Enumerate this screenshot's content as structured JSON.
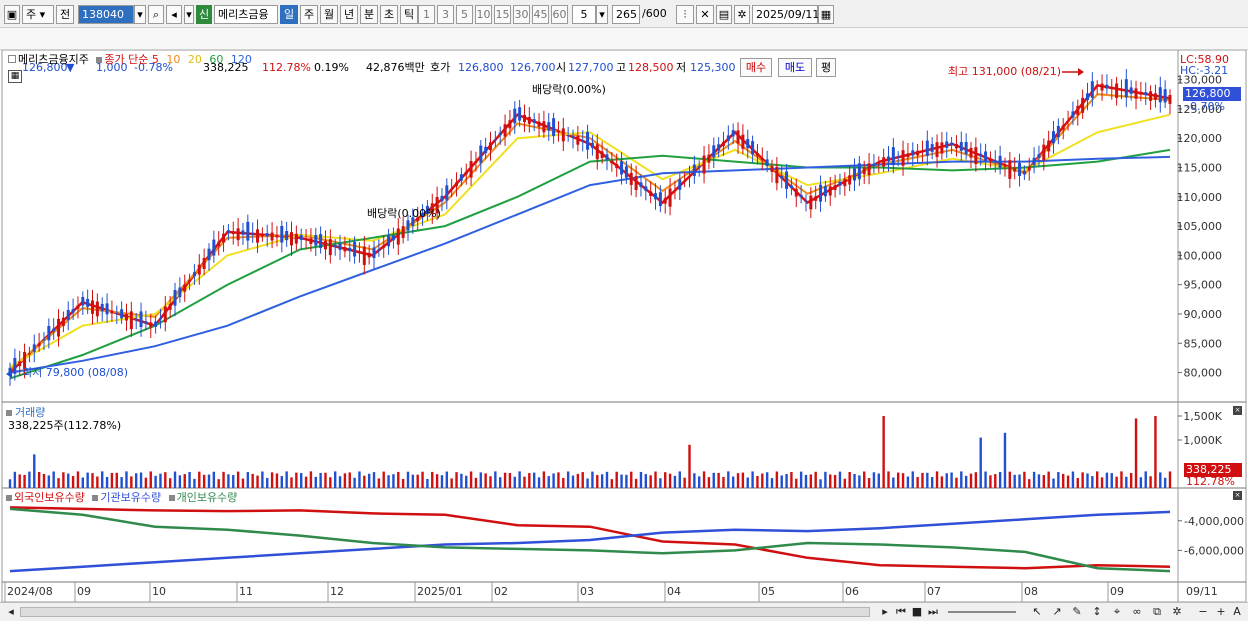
{
  "toolbar": {
    "period_main": "주",
    "prev_label": "전",
    "code": "138040",
    "new_badge": "신",
    "stock_name": "메리츠금융",
    "periods": [
      "일",
      "주",
      "월",
      "년",
      "분",
      "초",
      "틱"
    ],
    "active_period": "일",
    "intervals": [
      "1",
      "3",
      "5",
      "10",
      "15",
      "30",
      "45",
      "60"
    ],
    "interval_value": "5",
    "count_value": "265",
    "count_max": "/600",
    "date_value": "2025/09/11"
  },
  "quote": {
    "price": "126,800",
    "change_arrow": "▼",
    "change": "1,000",
    "change_pct": "-0.78%",
    "volume": "338,225",
    "volume_ratio": "112.78%",
    "turnover": "0.19%",
    "amount": "42,876백만",
    "bid_label": "호가",
    "bid": "126,800",
    "ask": "126,700",
    "open_label": "시",
    "open": "127,700",
    "high_label": "고",
    "high": "128,500",
    "low_label": "저",
    "low": "125,300",
    "buy_button": "매수",
    "sell_button": "매도",
    "eval_button": "평"
  },
  "legend": {
    "stock_name": "메리츠금융지주",
    "price_type": "종가 단순",
    "ma": [
      "5",
      "10",
      "20",
      "60",
      "120"
    ],
    "ma_colors": [
      "#e01010",
      "#f08a1a",
      "#f0e020",
      "#20a040",
      "#3060e0"
    ]
  },
  "price_panel": {
    "lc_label": "LC:58.90",
    "hc_label": "HC:-3.21",
    "current_price": "126,800",
    "current_pct": "-0.70%",
    "high_annotation": "최고 131,000 (08/21)",
    "low_annotation": "최저 79,800 (08/08)",
    "dividend_annotations": [
      "배당락(0.00%)",
      "배당락(0.00%)"
    ]
  },
  "volume_panel": {
    "title": "거래량",
    "subtitle": "338,225주(112.78%)",
    "current_volume": "338,225",
    "current_ratio": "112.78%"
  },
  "holdings_panel": {
    "series_labels": [
      "외국인보유수량",
      "기관보유수량",
      "개인보유수량"
    ]
  },
  "xaxis_labels": [
    "2024/08",
    "09",
    "10",
    "11",
    "12",
    "2025/01",
    "02",
    "03",
    "04",
    "05",
    "06",
    "07",
    "08",
    "09"
  ],
  "last_date_label": "09/11",
  "chart_data": [
    {
      "type": "line",
      "title": "메리츠금융지주 종가 단순",
      "ylim": [
        76000,
        133000
      ],
      "yticks": [
        80000,
        85000,
        90000,
        95000,
        100000,
        105000,
        110000,
        115000,
        120000,
        125000,
        130000
      ],
      "ytick_labels": [
        "80,000",
        "85,000",
        "90,000",
        "95,000",
        "100,000",
        "105,000",
        "110,000",
        "115,000",
        "120,000",
        "125,000",
        "130,000"
      ],
      "x": [
        "2024/08",
        "09",
        "10",
        "11",
        "12",
        "2025/01",
        "02",
        "03",
        "04",
        "05",
        "06",
        "07",
        "08",
        "09"
      ],
      "series": [
        {
          "name": "5",
          "values": [
            80000,
            92000,
            88000,
            104000,
            103000,
            100000,
            110000,
            124000,
            119000,
            109000,
            121000,
            109000,
            116000,
            119000,
            114000,
            129000,
            126800
          ]
        },
        {
          "name": "10",
          "values": [
            80500,
            91000,
            89500,
            103000,
            103500,
            101000,
            109000,
            122500,
            120000,
            111000,
            119500,
            110500,
            115500,
            118000,
            114000,
            127500,
            126500
          ]
        },
        {
          "name": "20",
          "values": [
            81000,
            88000,
            90000,
            100000,
            103500,
            102500,
            107000,
            120000,
            121000,
            113000,
            118000,
            112000,
            114000,
            116500,
            114500,
            121000,
            124000
          ]
        },
        {
          "name": "60",
          "values": [
            79000,
            83000,
            88000,
            95000,
            101000,
            103000,
            105000,
            110000,
            116000,
            117000,
            116000,
            115000,
            115000,
            114500,
            115000,
            116000,
            118000
          ]
        },
        {
          "name": "120",
          "values": [
            80000,
            82000,
            84500,
            88000,
            93000,
            97500,
            102000,
            107000,
            112000,
            114000,
            114500,
            115000,
            115500,
            116000,
            116000,
            116500,
            116800
          ]
        }
      ]
    },
    {
      "type": "bar",
      "title": "거래량",
      "ylim": [
        0,
        1500000
      ],
      "yticks": [
        1000000,
        1500000
      ],
      "ytick_labels": [
        "1,000K",
        "1,500K"
      ],
      "spikes": [
        {
          "x": "2024/08",
          "value": 700000
        },
        {
          "x": "05-06",
          "value": 1500000
        },
        {
          "x": "06",
          "value": 1150000
        },
        {
          "x": "08",
          "value": 1050000
        },
        {
          "x": "08",
          "value": 1450000
        }
      ],
      "typical_value": 330000
    },
    {
      "type": "line",
      "title": "보유수량",
      "yticks": [
        -4000000,
        -6000000
      ],
      "ytick_labels": [
        "-4,000,000",
        "-6,000,000"
      ],
      "series": [
        {
          "name": "외국인보유수량",
          "color": "#d01010"
        },
        {
          "name": "기관보유수량",
          "color": "#3050d8"
        },
        {
          "name": "개인보유수량",
          "color": "#2f8a4c"
        }
      ]
    }
  ]
}
